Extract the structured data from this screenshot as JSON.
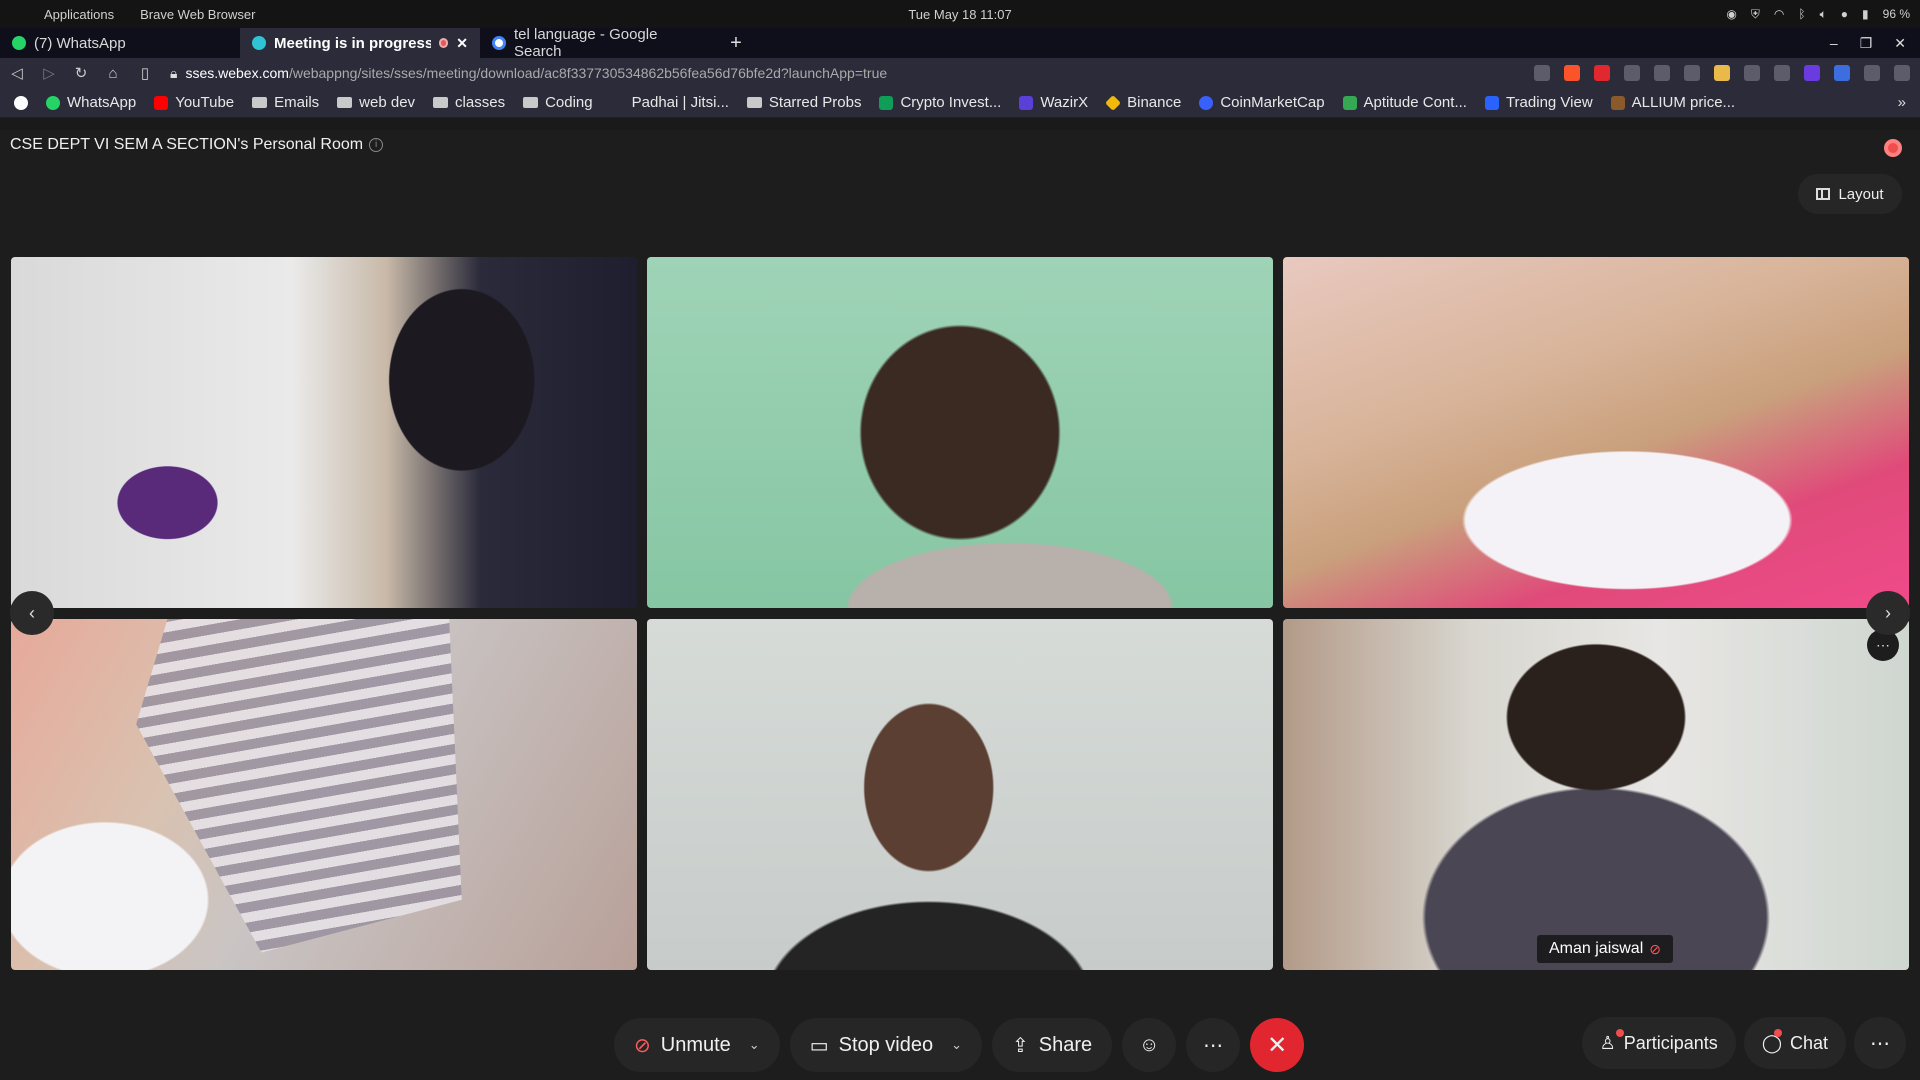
{
  "os_bar": {
    "menu_items": [
      "Applications",
      "Brave Web Browser"
    ],
    "clock": "Tue May 18  11:07",
    "battery": "96 %"
  },
  "tabs": [
    {
      "label": "(7) WhatsApp",
      "color": "#25d366"
    },
    {
      "label": "Meeting is in progress..",
      "color": "#2ec4d6"
    },
    {
      "label": "tel language - Google Search",
      "color": "#4285f4"
    }
  ],
  "url": {
    "host": "sses.webex.com",
    "path": "/webappng/sites/sses/meeting/download/ac8f337730534862b56fea56d76bfe2d?launchApp=true"
  },
  "bookmarks": [
    {
      "label": "WhatsApp",
      "kind": "site",
      "color": "#25d366"
    },
    {
      "label": "YouTube",
      "kind": "site",
      "color": "#ff0000"
    },
    {
      "label": "Emails",
      "kind": "folder"
    },
    {
      "label": "web dev",
      "kind": "folder"
    },
    {
      "label": "classes",
      "kind": "folder"
    },
    {
      "label": "Coding",
      "kind": "folder"
    },
    {
      "label": "Padhai | Jitsi...",
      "kind": "site",
      "color": "#2b2b3a"
    },
    {
      "label": "Starred Probs",
      "kind": "folder"
    },
    {
      "label": "Crypto Invest...",
      "kind": "site",
      "color": "#0f9d58"
    },
    {
      "label": "WazirX",
      "kind": "site",
      "color": "#5a3fd9"
    },
    {
      "label": "Binance",
      "kind": "site",
      "color": "#f0b90b"
    },
    {
      "label": "CoinMarketCap",
      "kind": "site",
      "color": "#3861fb"
    },
    {
      "label": "Aptitude Cont...",
      "kind": "site",
      "color": "#34a853"
    },
    {
      "label": "Trading View",
      "kind": "site",
      "color": "#2962ff"
    },
    {
      "label": "ALLIUM price...",
      "kind": "site",
      "color": "#8a5a2b"
    }
  ],
  "meeting": {
    "room_title": "CSE DEPT VI SEM A SECTION's Personal Room",
    "layout_label": "Layout",
    "participant_name": "Aman jaiswal",
    "controls": {
      "unmute": "Unmute",
      "stop_video": "Stop video",
      "share": "Share",
      "participants": "Participants",
      "chat": "Chat"
    }
  },
  "colors": {
    "end_call": "#e2262f",
    "recording": "#f04d4d",
    "background": "#1d1d1d"
  }
}
